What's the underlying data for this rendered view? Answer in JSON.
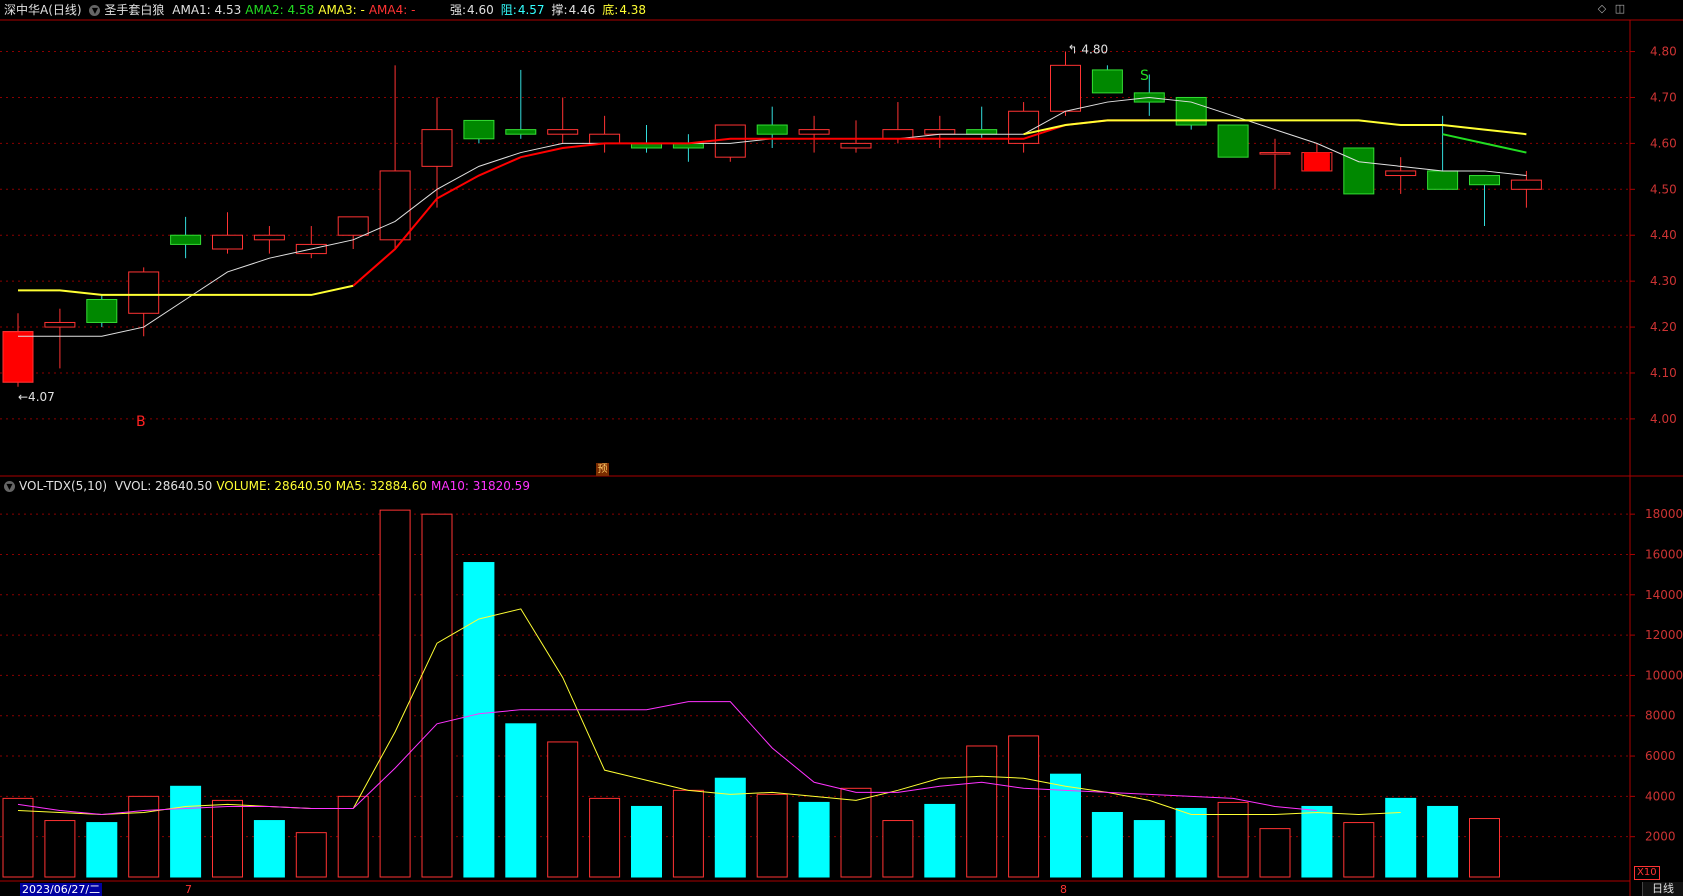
{
  "header": {
    "stock": "深中华A",
    "period": "(日线)",
    "indicator_name": "圣手套白狼",
    "items": [
      {
        "label": "AMA1: 4.53",
        "color": "#e0e0e0"
      },
      {
        "label": "AMA2: 4.58",
        "color": "#22dd22"
      },
      {
        "label": "AMA3: -",
        "color": "#ffff33"
      },
      {
        "label": "AMA4: -",
        "color": "#ff3333"
      }
    ],
    "levels": [
      {
        "label": "强:",
        "value": "4.60",
        "label_color": "#e0e0e0",
        "value_color": "#e0e0e0"
      },
      {
        "label": "阻:",
        "value": "4.57",
        "label_color": "#33ffff",
        "value_color": "#33ffff"
      },
      {
        "label": "撑:",
        "value": "4.46",
        "label_color": "#e0e0e0",
        "value_color": "#e0e0e0"
      },
      {
        "label": "底:",
        "value": "4.38",
        "label_color": "#ffff33",
        "value_color": "#ffff33"
      }
    ]
  },
  "vol_header": {
    "name": "VOL-TDX(5,10)",
    "items": [
      {
        "label": "VVOL: 28640.50",
        "color": "#e0e0e0"
      },
      {
        "label": "VOLUME: 28640.50",
        "color": "#ffff33"
      },
      {
        "label": "MA5: 32884.60",
        "color": "#ffff33"
      },
      {
        "label": "MA10: 31820.59",
        "color": "#ff33ff"
      }
    ]
  },
  "markers": {
    "low_label": "4.07",
    "high_label": "4.80",
    "buy": "B",
    "sell": "S",
    "forecast": "预"
  },
  "footer": {
    "date": "2023/06/27/二",
    "month7": "7",
    "month8": "8",
    "period_button": "日线",
    "zoom": "X10"
  },
  "colors": {
    "up": "#ff3333",
    "down_fill": "#008800",
    "down_border": "#22dd22",
    "vol_down": "#00ffff",
    "grid": "#8b0000"
  },
  "chart_data": [
    {
      "type": "candlestick",
      "title": "深中华A (日线)",
      "ylim": [
        3.88,
        4.86
      ],
      "y_ticks": [
        4.0,
        4.1,
        4.2,
        4.3,
        4.4,
        4.5,
        4.6,
        4.7,
        4.8
      ],
      "candles": [
        {
          "o": 4.08,
          "h": 4.23,
          "l": 4.07,
          "c": 4.19
        },
        {
          "o": 4.2,
          "h": 4.24,
          "l": 4.11,
          "c": 4.21
        },
        {
          "o": 4.26,
          "h": 4.27,
          "l": 4.2,
          "c": 4.21
        },
        {
          "o": 4.23,
          "h": 4.33,
          "l": 4.18,
          "c": 4.32
        },
        {
          "o": 4.4,
          "h": 4.44,
          "l": 4.35,
          "c": 4.38
        },
        {
          "o": 4.37,
          "h": 4.45,
          "l": 4.36,
          "c": 4.4
        },
        {
          "o": 4.39,
          "h": 4.42,
          "l": 4.36,
          "c": 4.4
        },
        {
          "o": 4.36,
          "h": 4.42,
          "l": 4.35,
          "c": 4.38
        },
        {
          "o": 4.4,
          "h": 4.44,
          "l": 4.37,
          "c": 4.44
        },
        {
          "o": 4.39,
          "h": 4.77,
          "l": 4.37,
          "c": 4.54
        },
        {
          "o": 4.55,
          "h": 4.7,
          "l": 4.46,
          "c": 4.63
        },
        {
          "o": 4.65,
          "h": 4.65,
          "l": 4.6,
          "c": 4.61
        },
        {
          "o": 4.63,
          "h": 4.76,
          "l": 4.61,
          "c": 4.62
        },
        {
          "o": 4.62,
          "h": 4.7,
          "l": 4.6,
          "c": 4.63
        },
        {
          "o": 4.6,
          "h": 4.66,
          "l": 4.58,
          "c": 4.62
        },
        {
          "o": 4.6,
          "h": 4.64,
          "l": 4.58,
          "c": 4.59
        },
        {
          "o": 4.6,
          "h": 4.62,
          "l": 4.56,
          "c": 4.59
        },
        {
          "o": 4.57,
          "h": 4.64,
          "l": 4.56,
          "c": 4.64
        },
        {
          "o": 4.64,
          "h": 4.68,
          "l": 4.59,
          "c": 4.62
        },
        {
          "o": 4.62,
          "h": 4.66,
          "l": 4.58,
          "c": 4.63
        },
        {
          "o": 4.59,
          "h": 4.65,
          "l": 4.58,
          "c": 4.6
        },
        {
          "o": 4.61,
          "h": 4.69,
          "l": 4.6,
          "c": 4.63
        },
        {
          "o": 4.62,
          "h": 4.66,
          "l": 4.59,
          "c": 4.63
        },
        {
          "o": 4.63,
          "h": 4.68,
          "l": 4.61,
          "c": 4.62
        },
        {
          "o": 4.6,
          "h": 4.69,
          "l": 4.58,
          "c": 4.67
        },
        {
          "o": 4.67,
          "h": 4.8,
          "l": 4.66,
          "c": 4.77
        },
        {
          "o": 4.76,
          "h": 4.77,
          "l": 4.71,
          "c": 4.71
        },
        {
          "o": 4.71,
          "h": 4.75,
          "l": 4.66,
          "c": 4.69
        },
        {
          "o": 4.7,
          "h": 4.7,
          "l": 4.63,
          "c": 4.64
        },
        {
          "o": 4.64,
          "h": 4.64,
          "l": 4.57,
          "c": 4.57
        },
        {
          "o": 4.58,
          "h": 4.61,
          "l": 4.5,
          "c": 4.58
        },
        {
          "o": 4.54,
          "h": 4.6,
          "l": 4.54,
          "c": 4.58
        },
        {
          "o": 4.59,
          "h": 4.59,
          "l": 4.49,
          "c": 4.49
        },
        {
          "o": 4.53,
          "h": 4.57,
          "l": 4.49,
          "c": 4.54
        },
        {
          "o": 4.54,
          "h": 4.66,
          "l": 4.5,
          "c": 4.5
        },
        {
          "o": 4.53,
          "h": 4.53,
          "l": 4.42,
          "c": 4.51
        },
        {
          "o": 4.5,
          "h": 4.54,
          "l": 4.46,
          "c": 4.52
        }
      ],
      "lines": [
        {
          "name": "AMA1",
          "color": "#e0e0e0",
          "values": [
            4.18,
            4.18,
            4.18,
            4.2,
            4.26,
            4.32,
            4.35,
            4.37,
            4.39,
            4.43,
            4.5,
            4.55,
            4.58,
            4.6,
            4.6,
            4.6,
            4.6,
            4.6,
            4.61,
            4.61,
            4.61,
            4.61,
            4.62,
            4.62,
            4.62,
            4.67,
            4.69,
            4.7,
            4.69,
            4.66,
            4.63,
            4.6,
            4.56,
            4.55,
            4.54,
            4.54,
            4.53
          ]
        },
        {
          "name": "AMA2",
          "segments": [
            {
              "color": "#ffff33",
              "values": [
                4.28,
                4.28,
                4.27,
                4.27,
                4.27,
                4.27,
                4.27,
                4.27,
                4.29
              ]
            },
            {
              "color": "#ff0000",
              "start": 8,
              "values": [
                4.29,
                4.37,
                4.48,
                4.53,
                4.57,
                4.59,
                4.6,
                4.6,
                4.6,
                4.61,
                4.61,
                4.61,
                4.61,
                4.61,
                4.61,
                4.61,
                4.61,
                4.64,
                4.65,
                4.65
              ]
            },
            {
              "color": "#ffff33",
              "start": 24,
              "values": [
                4.62,
                4.64,
                4.65,
                4.65,
                4.65,
                4.65,
                4.65,
                4.65,
                4.65,
                4.64,
                4.64,
                4.63,
                4.62
              ]
            },
            {
              "color": "#22dd22",
              "start": 34,
              "values": [
                4.62,
                4.6,
                4.58
              ]
            }
          ]
        }
      ]
    },
    {
      "type": "bar",
      "title": "VOL-TDX(5,10)",
      "ylim": [
        0,
        19000
      ],
      "y_ticks": [
        2000,
        4000,
        6000,
        8000,
        10000,
        12000,
        14000,
        16000,
        18000
      ],
      "values": [
        3900,
        2800,
        2700,
        4000,
        4500,
        3800,
        2800,
        2200,
        4000,
        18200,
        18000,
        15600,
        7600,
        6700,
        3900,
        3500,
        4300,
        4900,
        4100,
        3700,
        4400,
        2800,
        3600,
        6500,
        7000,
        5100,
        3200,
        2800,
        3400,
        3700,
        2400,
        3500,
        2700,
        3900,
        3500,
        2900
      ],
      "directions": [
        "up",
        "up",
        "down",
        "up",
        "down",
        "up",
        "down",
        "up",
        "up",
        "up",
        "up",
        "down",
        "down",
        "up",
        "up",
        "down",
        "up",
        "down",
        "up",
        "down",
        "up",
        "up",
        "down",
        "up",
        "up",
        "down",
        "down",
        "down",
        "down",
        "up",
        "up",
        "down",
        "up",
        "down",
        "down",
        "up"
      ],
      "series": [
        {
          "name": "MA5",
          "color": "#ffff33",
          "values": [
            3300,
            3200,
            3100,
            3200,
            3500,
            3600,
            3500,
            3400,
            3400,
            7200,
            11600,
            12800,
            13300,
            9900,
            5300,
            4800,
            4300,
            4100,
            4200,
            4000,
            3800,
            4300,
            4900,
            5000,
            4900,
            4500,
            4200,
            3800,
            3100,
            3100,
            3100,
            3200,
            3100,
            3200
          ]
        },
        {
          "name": "MA10",
          "color": "#ff33ff",
          "values": [
            3600,
            3300,
            3100,
            3300,
            3400,
            3500,
            3500,
            3400,
            3400,
            5400,
            7600,
            8100,
            8300,
            8300,
            8300,
            8300,
            8700,
            8700,
            6400,
            4700,
            4200,
            4200,
            4500,
            4700,
            4400,
            4300,
            4200,
            4100,
            4000,
            3900,
            3500,
            3300
          ]
        }
      ]
    }
  ]
}
